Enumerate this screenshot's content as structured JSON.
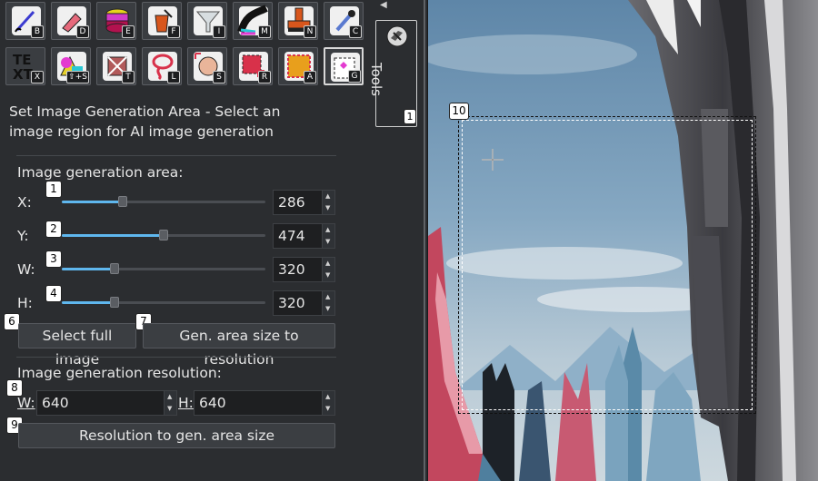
{
  "tools": [
    {
      "name": "brush-tool",
      "key": "B",
      "icon": "brush-icon"
    },
    {
      "name": "eraser-tool",
      "key": "D",
      "icon": "eraser-icon"
    },
    {
      "name": "layers-tool",
      "key": "E",
      "icon": "layers-icon"
    },
    {
      "name": "fill-tool",
      "key": "F",
      "icon": "bucket-icon"
    },
    {
      "name": "filter-tool",
      "key": "I",
      "icon": "funnel-icon"
    },
    {
      "name": "smudge-tool",
      "key": "M",
      "icon": "smudge-icon"
    },
    {
      "name": "stamp-tool",
      "key": "N",
      "icon": "stamp-icon"
    },
    {
      "name": "color-picker-tool",
      "key": "C",
      "icon": "eyedropper-icon"
    },
    {
      "name": "text-tool",
      "key": "X",
      "icon": "text-icon"
    },
    {
      "name": "shape-tool",
      "key": "⇧+S",
      "icon": "shapes-icon"
    },
    {
      "name": "transform-tool",
      "key": "T",
      "icon": "transform-icon"
    },
    {
      "name": "lasso-tool",
      "key": "L",
      "icon": "lasso-icon"
    },
    {
      "name": "face-select-tool",
      "key": "S",
      "icon": "face-select-icon"
    },
    {
      "name": "rect-select-tool",
      "key": "R",
      "icon": "rect-select-icon"
    },
    {
      "name": "area-tool",
      "key": "A",
      "icon": "area-icon"
    },
    {
      "name": "generation-area-tool",
      "key": "G",
      "icon": "generation-area-icon"
    }
  ],
  "description": "Set Image Generation Area - Select an image region for AI image generation",
  "gen_area": {
    "heading": "Image generation area:",
    "fields": [
      {
        "label": "X:",
        "value": "286",
        "badge": "1",
        "fill": 0.3
      },
      {
        "label": "Y:",
        "value": "474",
        "badge": "2",
        "fill": 0.5
      },
      {
        "label": "W:",
        "value": "320",
        "badge": "3",
        "fill": 0.26
      },
      {
        "label": "H:",
        "value": "320",
        "badge": "4",
        "fill": 0.26
      }
    ]
  },
  "buttons": {
    "select_full": "Select full image",
    "select_full_badge": "6",
    "gen_to_res": "Gen. area size to resolution",
    "gen_to_res_badge": "7",
    "res_to_gen": "Resolution to gen. area size",
    "res_to_gen_badge": "9"
  },
  "resolution": {
    "heading": "Image generation resolution:",
    "w_label": "W:",
    "w_value": "640",
    "h_label": "H:",
    "h_value": "640",
    "badge": "8"
  },
  "side_tab": {
    "label": "Tools",
    "badge": "1",
    "collapse_icon": "chevron-left-icon"
  },
  "canvas": {
    "badge": "10",
    "crosshair_icon": "crosshair-icon"
  }
}
